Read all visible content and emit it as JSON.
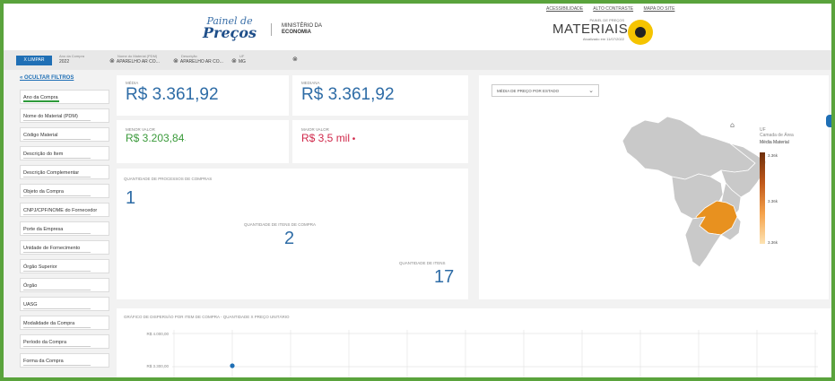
{
  "header": {
    "logo_line1": "Painel de",
    "logo_line2": "Preços",
    "ministry_line1": "MINISTÉRIO DA",
    "ministry_line2": "ECONOMIA",
    "top_links": [
      "ACESSIBILIDADE",
      "ALTO CONTRASTE",
      "MAPA DO SITE"
    ],
    "panel_small": "PAINEL DE PREÇOS",
    "panel_name": "MATERIAIS",
    "updated": "Atualizado em 11/07/2022"
  },
  "filter_bar": {
    "clear_label": "X LIMPAR",
    "chips": [
      {
        "title": "Ano da Compra",
        "value": "2022",
        "removable": false
      },
      {
        "title": "Nome do Material (PDM)",
        "value": "APARELHO AR CO...",
        "removable": true
      },
      {
        "title": "Descrição",
        "value": "APARELHO AR CO...",
        "removable": true
      },
      {
        "title": "UF",
        "value": "MG",
        "removable": true
      }
    ]
  },
  "sidebar": {
    "hide_filters": "OCULTAR FILTROS",
    "items": [
      "Ano da Compra",
      "Nome do Material (PDM)",
      "Código Material",
      "Descrição do Item",
      "Descrição Complementar",
      "Objeto da Compra",
      "CNPJ/CPF/NOME do Fornecedor",
      "Porte da Empresa",
      "Unidade de Fornecimento",
      "Órgão Superior",
      "Órgão",
      "UASG",
      "Modalidade da Compra",
      "Período da Compra",
      "Forma da Compra"
    ]
  },
  "stats": {
    "media_label": "MÉDIA",
    "media_value": "R$ 3.361,92",
    "mediana_label": "MEDIANA",
    "mediana_value": "R$ 3.361,92",
    "menor_label": "MENOR VALOR",
    "menor_value": "R$ 3.203,84",
    "maior_label": "MAIOR VALOR",
    "maior_value": "R$ 3,5 mil",
    "processos_label": "QUANTIDADE DE PROCESSOS DE COMPRAS",
    "processos_value": "1",
    "itens_compra_label": "QUANTIDADE DE ITENS DE COMPRA",
    "itens_compra_value": "2",
    "itens_label": "QUANTIDADE DE ITENS",
    "itens_value": "17"
  },
  "map": {
    "dropdown_label": "MÉDIA DE PREÇO POR ESTADO",
    "legend_uf": "UF",
    "legend_layer": "Camada de Área",
    "legend_metric": "Média Material",
    "legend_max": "3.36k",
    "legend_mid": "3.36k",
    "legend_min": "3.36k",
    "highlight_color": "#e8911f",
    "base_color": "#c9c9c9"
  },
  "scatter": {
    "title": "GRÁFICO DE DISPERSÃO POR ITEM DE COMPRA - QUANTIDADE X PREÇO UNITÁRIO",
    "y_labels": [
      "R$ 4.000,00",
      "R$ 3.300,00"
    ],
    "point_color": "#1f6fb5"
  }
}
